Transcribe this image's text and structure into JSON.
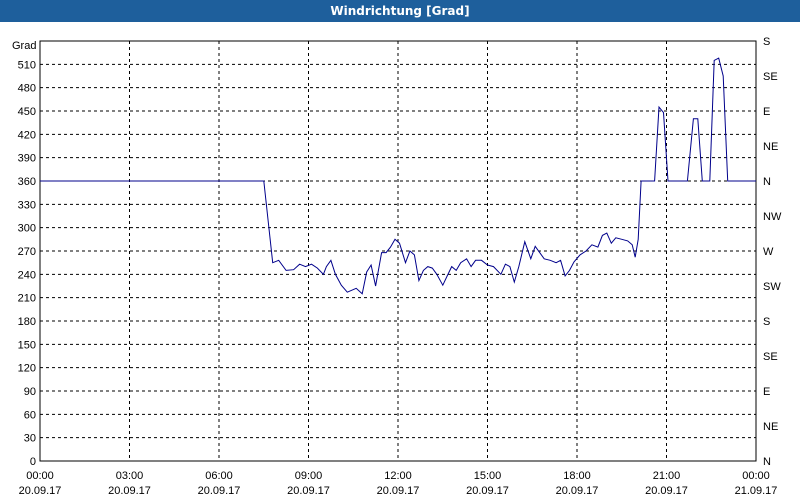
{
  "window": {
    "title": "Windrichtung [Grad]"
  },
  "chart_data": {
    "type": "line",
    "title": "Windrichtung [Grad]",
    "ylabel": "Grad",
    "ylim": [
      0,
      540
    ],
    "xlim_hours": [
      0,
      24
    ],
    "y_ticks": [
      0,
      30,
      60,
      90,
      120,
      150,
      180,
      210,
      240,
      270,
      300,
      330,
      360,
      390,
      420,
      450,
      480,
      510
    ],
    "y_right_ticks": [
      {
        "value": 0,
        "label": "N"
      },
      {
        "value": 45,
        "label": "NE"
      },
      {
        "value": 90,
        "label": "E"
      },
      {
        "value": 135,
        "label": "SE"
      },
      {
        "value": 180,
        "label": "S"
      },
      {
        "value": 225,
        "label": "SW"
      },
      {
        "value": 270,
        "label": "W"
      },
      {
        "value": 315,
        "label": "NW"
      },
      {
        "value": 360,
        "label": "N"
      },
      {
        "value": 405,
        "label": "NE"
      },
      {
        "value": 450,
        "label": "E"
      },
      {
        "value": 495,
        "label": "SE"
      },
      {
        "value": 540,
        "label": "S"
      }
    ],
    "x_ticks": [
      {
        "hour": 0,
        "time": "00:00",
        "date": "20.09.17"
      },
      {
        "hour": 3,
        "time": "03:00",
        "date": "20.09.17"
      },
      {
        "hour": 6,
        "time": "06:00",
        "date": "20.09.17"
      },
      {
        "hour": 9,
        "time": "09:00",
        "date": "20.09.17"
      },
      {
        "hour": 12,
        "time": "12:00",
        "date": "20.09.17"
      },
      {
        "hour": 15,
        "time": "15:00",
        "date": "20.09.17"
      },
      {
        "hour": 18,
        "time": "18:00",
        "date": "20.09.17"
      },
      {
        "hour": 21,
        "time": "21:00",
        "date": "20.09.17"
      },
      {
        "hour": 24,
        "time": "00:00",
        "date": "21.09.17"
      }
    ],
    "grid": true,
    "color": "#00008b",
    "series": [
      {
        "points": [
          [
            0.0,
            360
          ],
          [
            7.5,
            360
          ],
          [
            7.8,
            255
          ],
          [
            8.0,
            258
          ],
          [
            8.25,
            245
          ],
          [
            8.5,
            246
          ],
          [
            8.7,
            253
          ],
          [
            8.9,
            250
          ],
          [
            9.1,
            253
          ],
          [
            9.3,
            248
          ],
          [
            9.5,
            240
          ],
          [
            9.6,
            250
          ],
          [
            9.75,
            258
          ],
          [
            9.9,
            240
          ],
          [
            10.1,
            226
          ],
          [
            10.3,
            217
          ],
          [
            10.6,
            222
          ],
          [
            10.8,
            215
          ],
          [
            10.95,
            243
          ],
          [
            11.1,
            252
          ],
          [
            11.25,
            225
          ],
          [
            11.45,
            268
          ],
          [
            11.6,
            268
          ],
          [
            11.75,
            275
          ],
          [
            11.9,
            285
          ],
          [
            12.05,
            280
          ],
          [
            12.25,
            255
          ],
          [
            12.4,
            270
          ],
          [
            12.55,
            265
          ],
          [
            12.7,
            232
          ],
          [
            12.85,
            245
          ],
          [
            13.0,
            250
          ],
          [
            13.15,
            248
          ],
          [
            13.3,
            240
          ],
          [
            13.5,
            226
          ],
          [
            13.65,
            238
          ],
          [
            13.8,
            250
          ],
          [
            13.95,
            245
          ],
          [
            14.1,
            255
          ],
          [
            14.3,
            260
          ],
          [
            14.45,
            250
          ],
          [
            14.6,
            258
          ],
          [
            14.8,
            258
          ],
          [
            15.0,
            252
          ],
          [
            15.2,
            250
          ],
          [
            15.45,
            240
          ],
          [
            15.6,
            253
          ],
          [
            15.75,
            250
          ],
          [
            15.9,
            230
          ],
          [
            16.05,
            250
          ],
          [
            16.25,
            282
          ],
          [
            16.45,
            260
          ],
          [
            16.6,
            276
          ],
          [
            16.75,
            268
          ],
          [
            16.9,
            260
          ],
          [
            17.1,
            258
          ],
          [
            17.3,
            255
          ],
          [
            17.45,
            258
          ],
          [
            17.6,
            238
          ],
          [
            17.75,
            245
          ],
          [
            17.9,
            256
          ],
          [
            18.1,
            265
          ],
          [
            18.3,
            270
          ],
          [
            18.5,
            278
          ],
          [
            18.7,
            275
          ],
          [
            18.85,
            290
          ],
          [
            19.0,
            293
          ],
          [
            19.15,
            280
          ],
          [
            19.3,
            287
          ],
          [
            19.5,
            285
          ],
          [
            19.7,
            283
          ],
          [
            19.85,
            278
          ],
          [
            19.95,
            262
          ],
          [
            20.05,
            285
          ],
          [
            20.15,
            360
          ],
          [
            20.6,
            360
          ],
          [
            20.75,
            455
          ],
          [
            20.9,
            448
          ],
          [
            21.05,
            360
          ],
          [
            21.15,
            360
          ],
          [
            21.7,
            360
          ],
          [
            21.9,
            440
          ],
          [
            22.05,
            440
          ],
          [
            22.2,
            360
          ],
          [
            22.45,
            360
          ],
          [
            22.6,
            515
          ],
          [
            22.75,
            518
          ],
          [
            22.9,
            495
          ],
          [
            23.05,
            360
          ],
          [
            24.0,
            360
          ]
        ]
      }
    ]
  }
}
